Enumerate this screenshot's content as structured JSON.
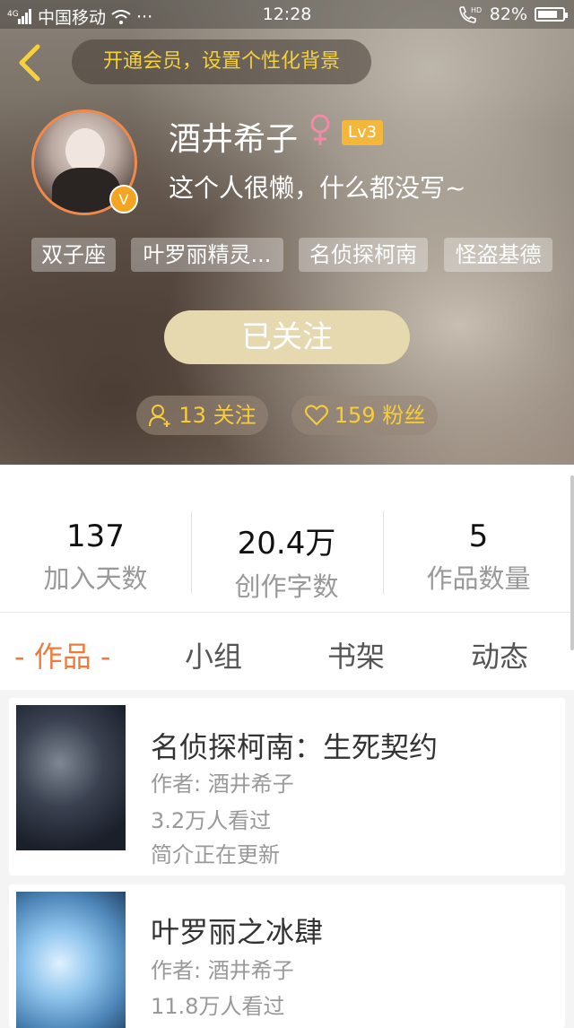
{
  "status_bar": {
    "carrier": "中国移动",
    "network": "4G",
    "dots": "···",
    "time": "12:28",
    "hd": "HD",
    "battery": "82%",
    "battery_level": 0.82
  },
  "header": {
    "vip_prompt": "开通会员，设置个性化背景",
    "username": "酒井希子",
    "level": "Lv3",
    "badge": "V",
    "bio": "这个人很懒，什么都没写~",
    "tags": [
      "双子座",
      "叶罗丽精灵...",
      "名侦探柯南",
      "怪盗基德"
    ],
    "follow_button": "已关注",
    "following": "13 关注",
    "fans": "159 粉丝"
  },
  "stats": [
    {
      "value": "137",
      "label": "加入天数"
    },
    {
      "value": "20.4万",
      "label": "创作字数"
    },
    {
      "value": "5",
      "label": "作品数量"
    }
  ],
  "tabs": [
    "- 作品 -",
    "小组",
    "书架",
    "动态"
  ],
  "works": [
    {
      "title": "名侦探柯南：生死契约",
      "author": "作者: 酒井希子",
      "views": "3.2万人看过",
      "summary": "简介正在更新"
    },
    {
      "title": "叶罗丽之冰肆",
      "author": "作者: 酒井希子",
      "views": "11.8万人看过"
    }
  ],
  "colors": {
    "accent": "#f07a3a",
    "vip_text": "#f5d23c",
    "follow_btn": "#e6d9b0",
    "level_badge": "#f3b83b"
  },
  "icons": [
    "back-arrow-icon",
    "signal-icon",
    "wifi-icon",
    "phone-hd-icon",
    "battery-icon",
    "female-icon",
    "add-person-icon",
    "heart-icon",
    "verified-badge-icon"
  ]
}
